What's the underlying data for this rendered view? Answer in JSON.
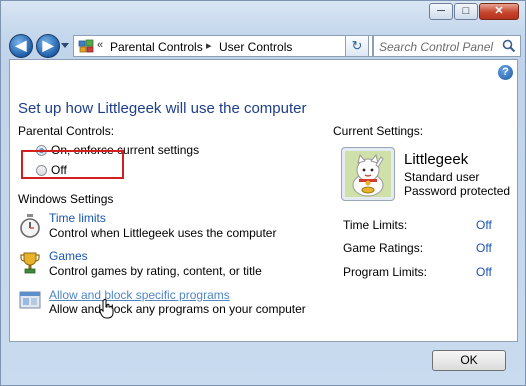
{
  "window": {
    "minimize": "─",
    "maximize": "□",
    "close": "✕"
  },
  "nav": {
    "back": "◀",
    "forward": "▶",
    "breadcrumb_prefix": "«",
    "breadcrumb": [
      "Parental Controls",
      "User Controls"
    ],
    "separator": "▸",
    "refresh": "↻",
    "search_placeholder": "Search Control Panel"
  },
  "content": {
    "help": "?",
    "heading": "Set up how Littlegeek will use the computer",
    "parental_controls": {
      "label": "Parental Controls:",
      "option_on": "On, enforce current settings",
      "option_off": "Off",
      "selected": "on"
    },
    "windows_settings": {
      "label": "Windows Settings",
      "items": [
        {
          "title": "Time limits",
          "description": "Control when Littlegeek uses the computer",
          "icon": "clock-icon"
        },
        {
          "title": "Games",
          "description": "Control games by rating, content, or title",
          "icon": "trophy-icon"
        },
        {
          "title": "Allow and block specific programs",
          "description": "Allow and block any programs on your computer",
          "icon": "programs-icon"
        }
      ]
    },
    "current_settings": {
      "label": "Current Settings:",
      "user_name": "Littlegeek",
      "account_type": "Standard user",
      "password_status": "Password protected",
      "rows": [
        {
          "key": "Time Limits:",
          "value": "Off"
        },
        {
          "key": "Game Ratings:",
          "value": "Off"
        },
        {
          "key": "Program Limits:",
          "value": "Off"
        }
      ]
    }
  },
  "footer": {
    "ok_label": "OK"
  },
  "colors": {
    "heading": "#1e3e8a",
    "link": "#1a55b0",
    "highlight_box": "#d21f1f"
  }
}
